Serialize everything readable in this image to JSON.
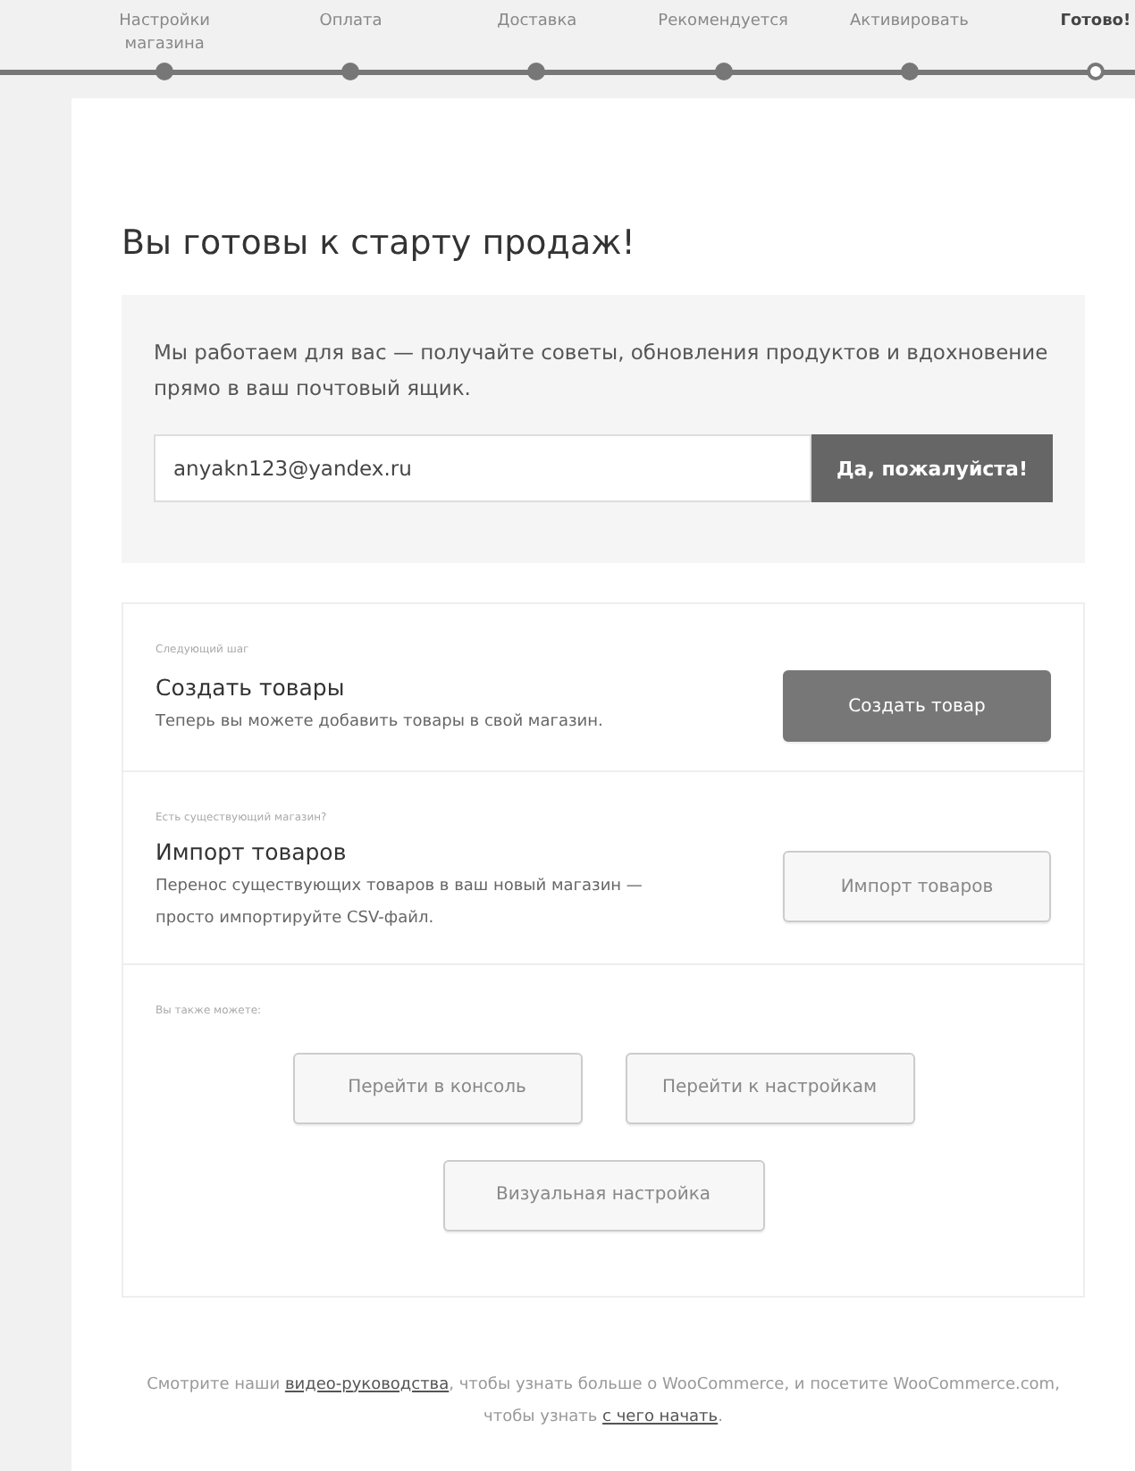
{
  "steps": [
    {
      "label": "Настройки магазина",
      "selected": false,
      "done": true
    },
    {
      "label": "Оплата",
      "selected": false,
      "done": true
    },
    {
      "label": "Доставка",
      "selected": false,
      "done": true
    },
    {
      "label": "Рекомендуется",
      "selected": false,
      "done": true
    },
    {
      "label": "Активировать",
      "selected": false,
      "done": true
    },
    {
      "label": "Готово!",
      "selected": true,
      "done": false
    }
  ],
  "title": "Вы готовы к старту продаж!",
  "newsletter": {
    "text": "Мы работаем для вас — получайте советы, обновления продуктов и вдохновение прямо в ваш почтовый ящик.",
    "email": "anyakn123@yandex.ru",
    "button": "Да, пожалуйста!"
  },
  "next_steps": [
    {
      "kind": "action",
      "caption": "Следующий шаг",
      "title": "Создать товары",
      "text": "Теперь вы можете добавить товары в свой магазин.",
      "button": "Создать товар",
      "primary": true
    },
    {
      "kind": "action",
      "caption": "Есть существующий магазин?",
      "title": "Импорт товаров",
      "text": "Перенос существующих товаров в ваш новый магазин — просто импортируйте CSV-файл.",
      "button": "Импорт товаров",
      "primary": false
    },
    {
      "kind": "links",
      "caption": "Вы также можете:",
      "buttons": [
        "Перейти в консоль",
        "Перейти к настройкам",
        "Визуальная настройка"
      ]
    }
  ],
  "footer": [
    {
      "kind": "text",
      "text": "Смотрите наши "
    },
    {
      "kind": "link",
      "text": "видео-руководства"
    },
    {
      "kind": "text",
      "text": ", чтобы узнать больше о WooCommerce, и посетите WooCommerce.com, чтобы узнать "
    },
    {
      "kind": "link",
      "text": "с чего начать"
    },
    {
      "kind": "text",
      "text": "."
    }
  ]
}
